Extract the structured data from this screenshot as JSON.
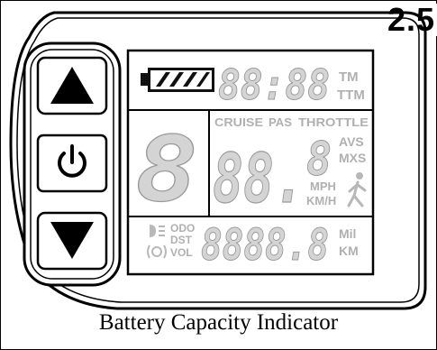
{
  "section_number": "2.5",
  "caption": "Battery Capacity Indicator",
  "buttons": {
    "up_icon": "triangle-up-icon",
    "power_icon": "power-icon",
    "down_icon": "triangle-down-icon"
  },
  "lcd": {
    "battery_icon": "battery-icon",
    "battery_level_fraction": 1.0,
    "clock": {
      "digits": "88:88",
      "labels": [
        "TM",
        "TTM"
      ]
    },
    "mode_labels": [
      "CRUISE",
      "PAS",
      "THROTTLE"
    ],
    "assist_level_digit": "8",
    "speed": {
      "digits": "88.",
      "small_digit": "8",
      "stat_labels": [
        "AVS",
        "MXS"
      ],
      "unit_labels": [
        "MPH",
        "KM/H"
      ]
    },
    "walk_icon": "walk-assist-icon",
    "trip": {
      "digits": "8888.8",
      "labels": [
        "ODO",
        "DST",
        "VOL"
      ],
      "unit_labels": [
        "Mil",
        "KM"
      ]
    },
    "headlight_icon": "headlight-icon",
    "error_icon": "error-icon"
  },
  "colors": {
    "segment": "#d4d4d4",
    "segment_stroke": "#9a9a9a",
    "bezel": "#000000",
    "battery_fill": "#111111"
  }
}
